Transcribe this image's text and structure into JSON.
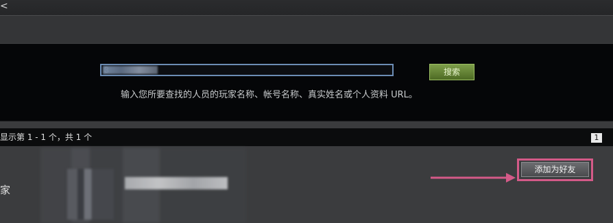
{
  "topbar": {
    "glyph": "<"
  },
  "search": {
    "input_value": "3",
    "button_label": "搜索",
    "hint": "输入您所要查找的人员的玩家名称、帐号名称、真实姓名或个人资料 URL。"
  },
  "results": {
    "summary": "显示第 1 - 1 个，共 1 个",
    "page": "1",
    "add_friend_label": "添加为好友",
    "side_text": "家"
  },
  "colors": {
    "accent_green": "#7e9e4a",
    "input_border": "#6c8db5",
    "highlight_pink": "#d45a88"
  }
}
